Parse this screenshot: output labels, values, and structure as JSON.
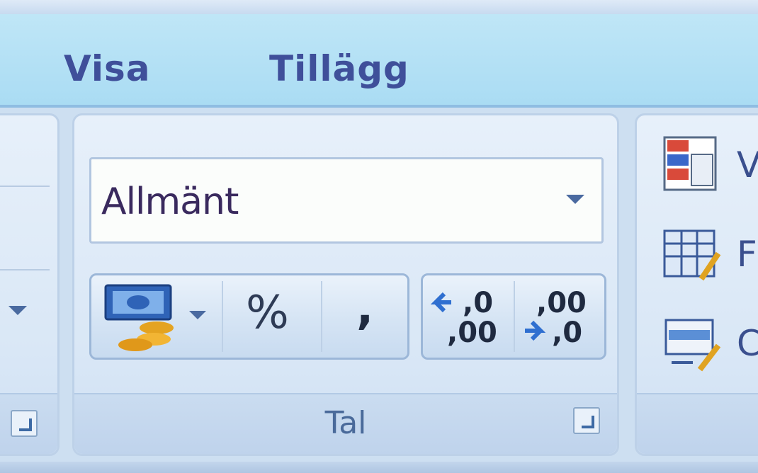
{
  "tabs": [
    {
      "label": "Visa"
    },
    {
      "label": "Tillägg"
    }
  ],
  "number_group": {
    "label": "Tal",
    "format_dropdown": {
      "selected": "Allmänt"
    },
    "buttons": {
      "currency": "accounting-number-format-icon",
      "percent_symbol": "%",
      "comma_symbol": ",",
      "increase_decimal": {
        "top": ",0",
        "bottom": ",00"
      },
      "decrease_decimal": {
        "top": ",00",
        "bottom": ",0"
      }
    }
  },
  "right_group": {
    "items": [
      {
        "icon": "conditional-formatting-icon",
        "label": "V"
      },
      {
        "icon": "format-as-table-icon",
        "label": "F"
      },
      {
        "icon": "cell-styles-icon",
        "label": "C"
      }
    ]
  },
  "colors": {
    "tab_bar": "#aadcf3",
    "tab_text": "#3f4f9a",
    "group_label": "#4a6a9a"
  }
}
